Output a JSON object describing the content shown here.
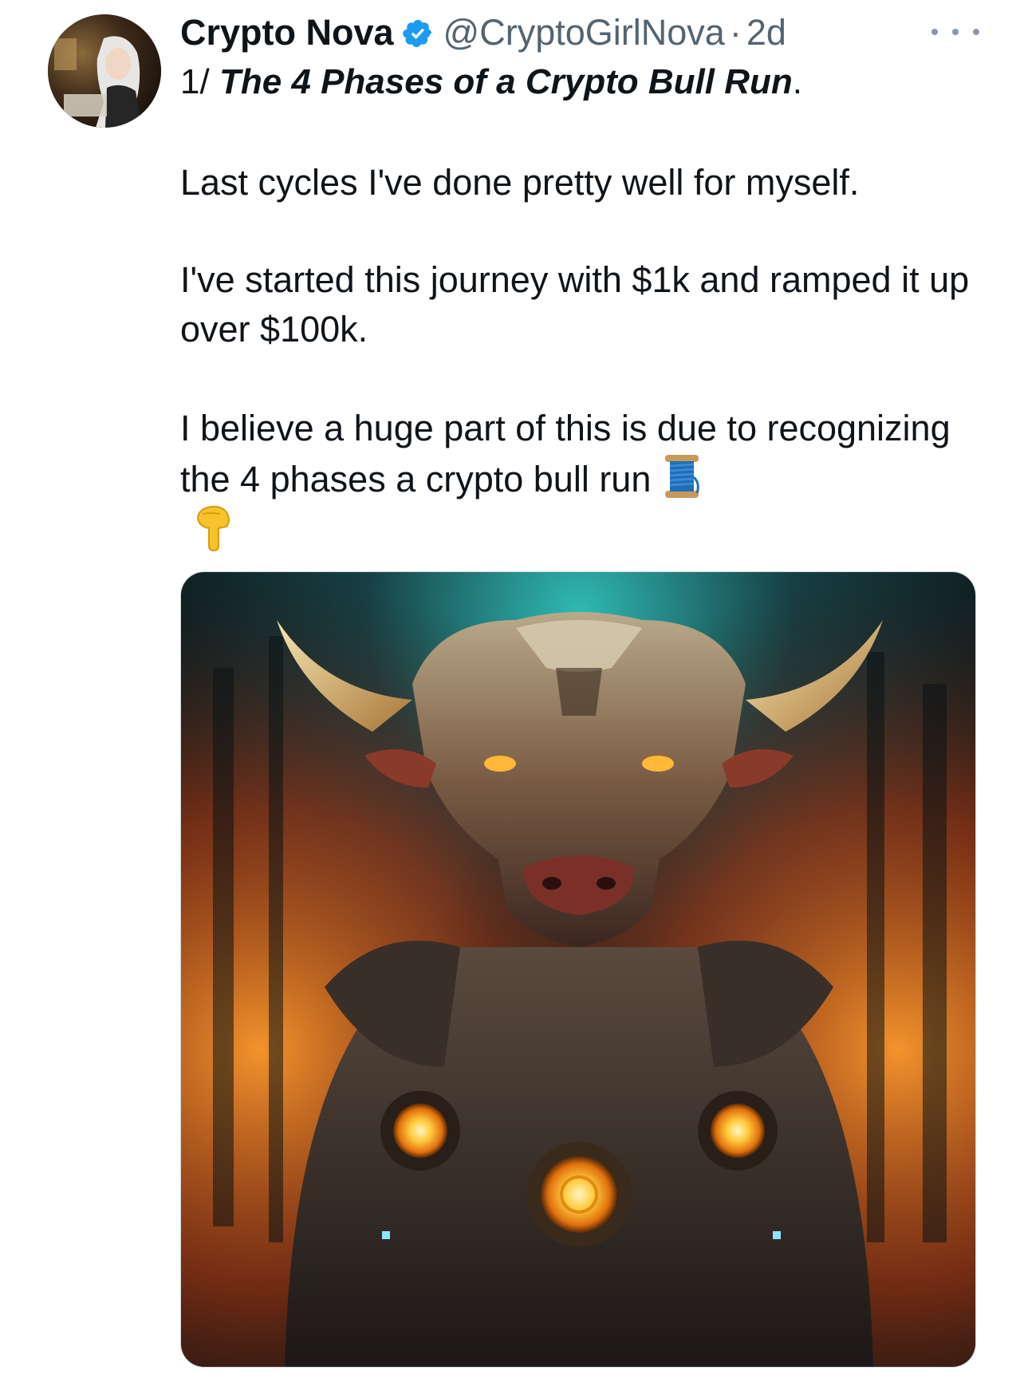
{
  "tweet": {
    "author": {
      "display_name": "Crypto Nova",
      "handle": "@CryptoGirlNova",
      "separator": "·",
      "time": "2d",
      "verified": true,
      "verified_color": "#1d9bf0"
    },
    "thread_prefix": "1/",
    "thread_title": "The 4 Phases of a Crypto Bull Run",
    "thread_title_end": ".",
    "paragraphs": [
      "Last cycles I've done pretty well for myself.",
      "I've started this journey with $1k and ramped it up over $100k.",
      "I believe a huge part of this is due to recognizing the 4 phases a crypto bull run"
    ],
    "emojis": {
      "thread_icon": "spool-of-thread-emoji",
      "pointing_down": "backhand-index-pointing-down-emoji"
    },
    "media": {
      "alt_subject": "armored-bull-illustration"
    },
    "more_icon": "more-options-icon"
  }
}
